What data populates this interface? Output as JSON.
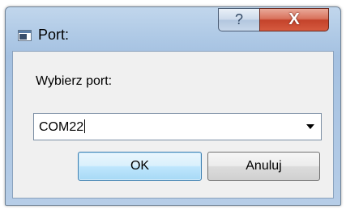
{
  "window": {
    "title": "Port:",
    "app_icon": "window-icon",
    "help_label": "?",
    "close_label": "X"
  },
  "dialog": {
    "prompt": "Wybierz port:",
    "combo": {
      "value": "COM22",
      "arrow_icon": "chevron-down-icon"
    },
    "ok_label": "OK",
    "cancel_label": "Anuluj"
  },
  "colors": {
    "accent": "#3c7fb1",
    "close": "#c4432b"
  }
}
